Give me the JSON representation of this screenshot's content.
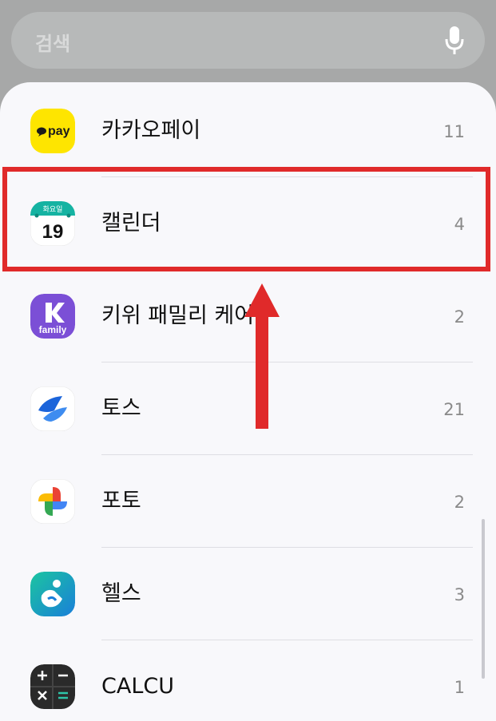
{
  "search": {
    "placeholder": "검색",
    "mic_icon": "microphone-icon"
  },
  "apps": [
    {
      "name": "카카오페이",
      "count": "11",
      "icon": "kakaopay-icon",
      "icon_text": "pay",
      "color": "#fee500"
    },
    {
      "name": "캘린더",
      "count": "4",
      "icon": "calendar-icon",
      "icon_day": "화요일",
      "icon_date": "19",
      "color": "#15b3a2"
    },
    {
      "name": "키위 패밀리 케어",
      "count": "2",
      "icon": "kiwi-family-icon",
      "icon_text": "family",
      "color": "#7b4fd6"
    },
    {
      "name": "토스",
      "count": "21",
      "icon": "toss-icon",
      "color": "#1b64da"
    },
    {
      "name": "포토",
      "count": "2",
      "icon": "photos-icon"
    },
    {
      "name": "헬스",
      "count": "3",
      "icon": "health-icon",
      "color": "#17a2b8"
    },
    {
      "name": "CALCU",
      "count": "1",
      "icon": "calculator-icon",
      "color": "#2a2a2a"
    }
  ],
  "annotation": {
    "highlight_color": "#e02a2a",
    "highlighted_item": "캘린더"
  }
}
